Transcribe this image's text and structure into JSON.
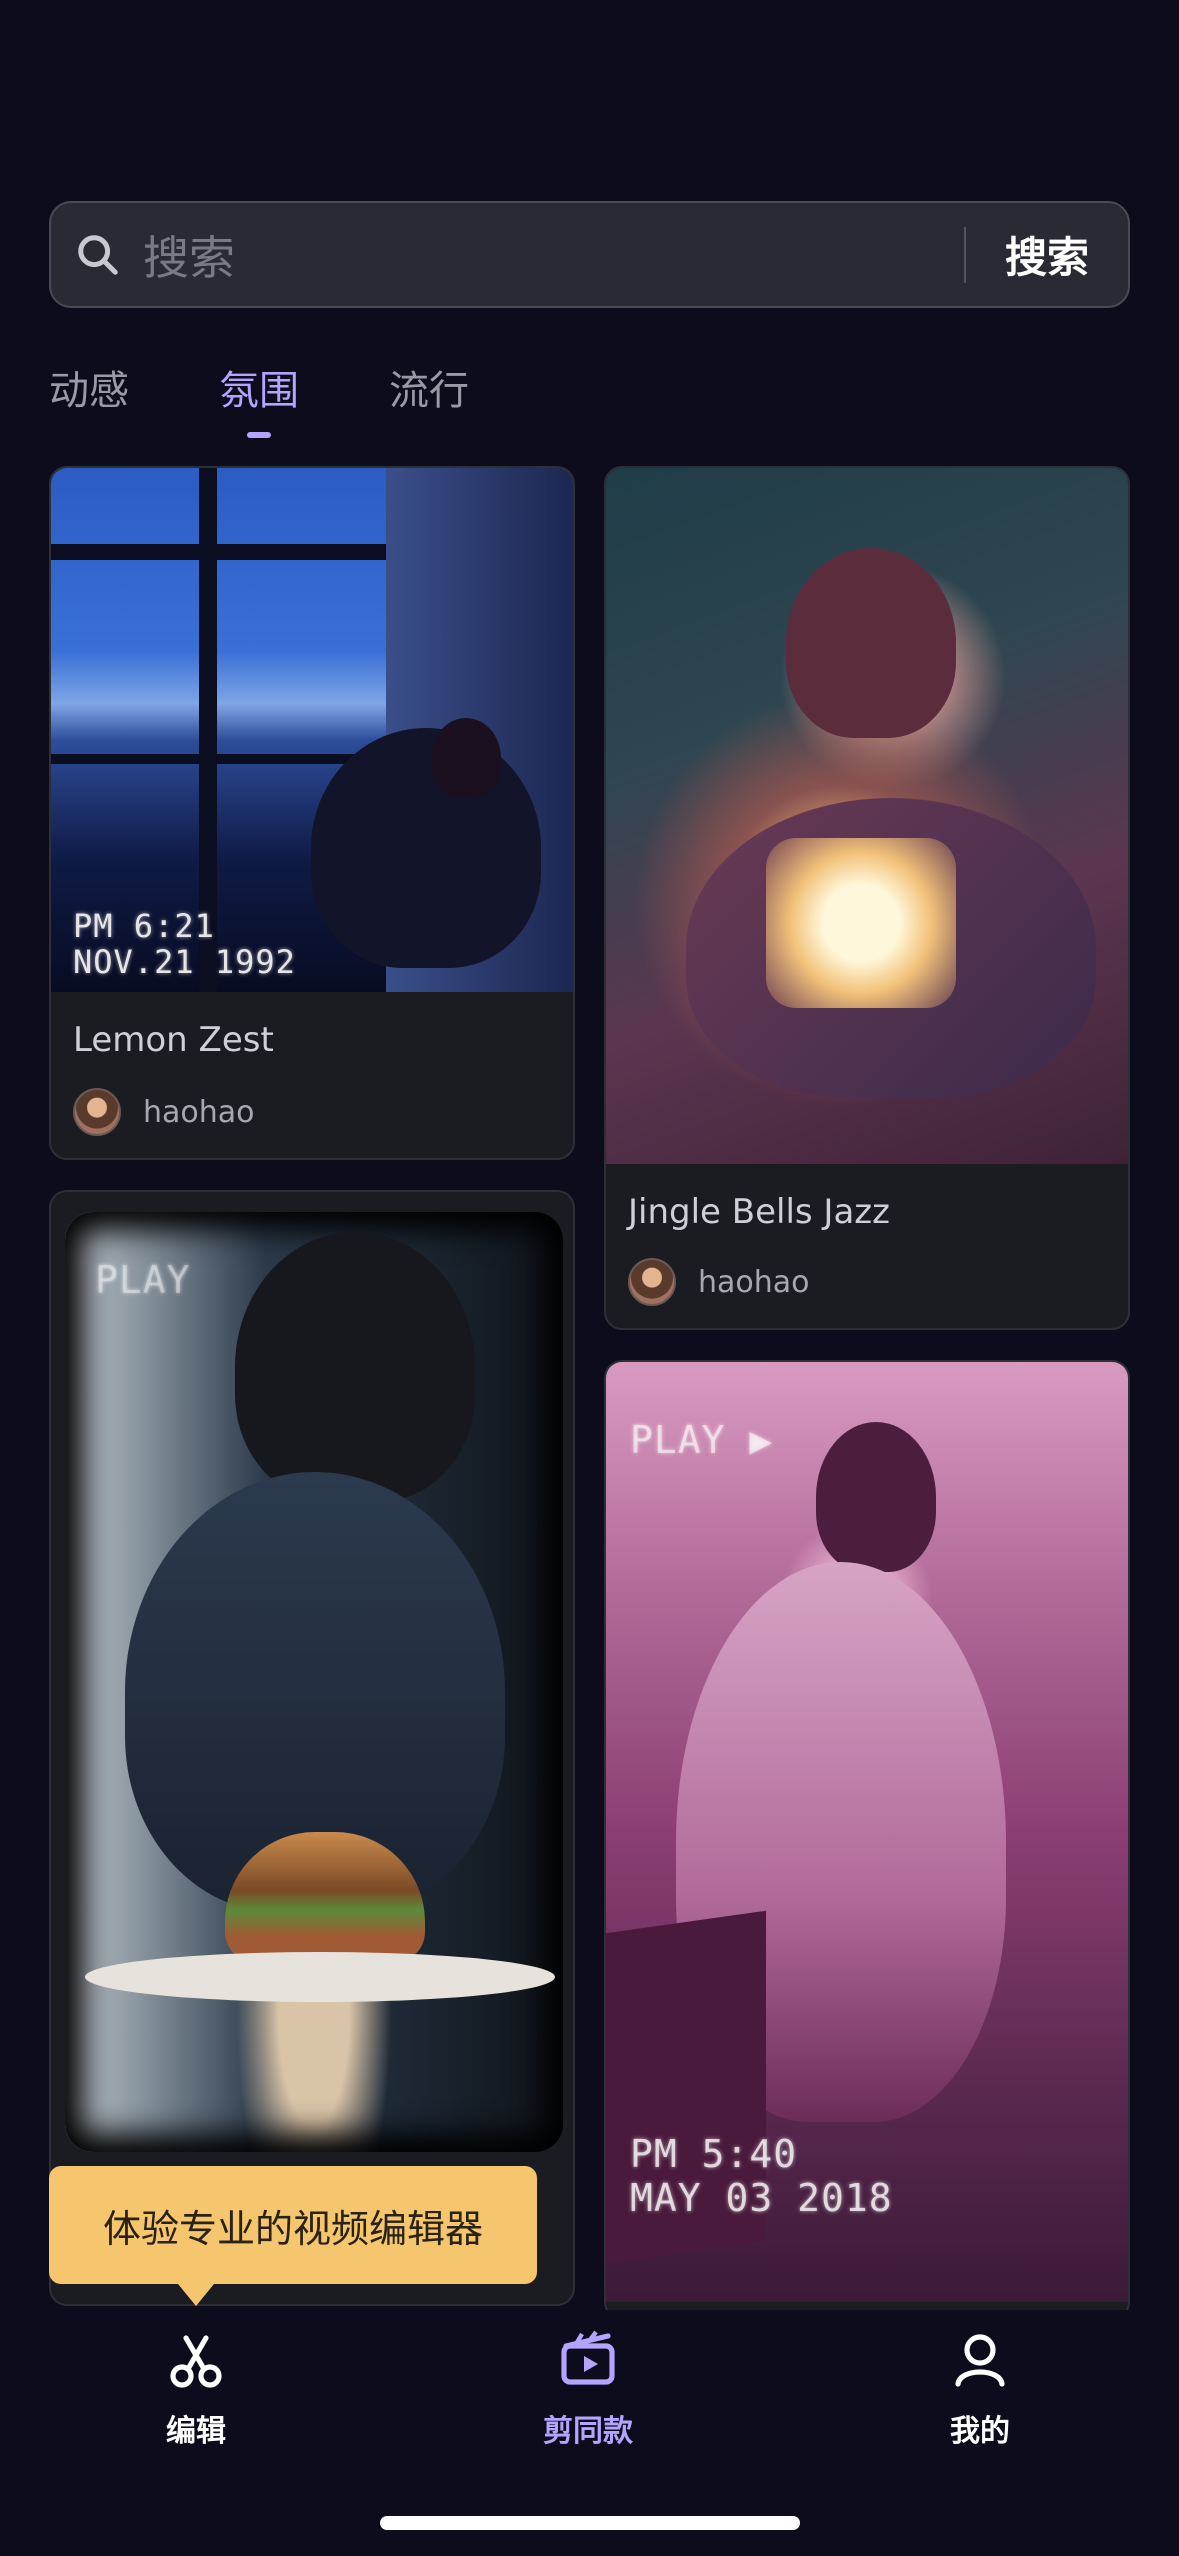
{
  "search": {
    "placeholder": "搜索",
    "button_label": "搜索"
  },
  "tabs": [
    {
      "label": "动感",
      "active": false
    },
    {
      "label": "氛围",
      "active": true
    },
    {
      "label": "流行",
      "active": false
    }
  ],
  "cards": [
    {
      "title": "Lemon Zest",
      "author": "haohao",
      "stamp": [
        "PM 6:21",
        "NOV.21 1992"
      ]
    },
    {
      "title": "Jingle Bells Jazz",
      "author": "haohao"
    },
    {
      "title": "",
      "author": "",
      "stamp": [
        "PLAY"
      ]
    },
    {
      "title": "",
      "author": "",
      "stamp": [
        "PLAY ▶",
        "PM 5:40",
        "MAY 03 2018"
      ]
    }
  ],
  "tooltip": {
    "text": "体验专业的视频编辑器"
  },
  "nav": [
    {
      "label": "编辑",
      "icon": "scissors-icon",
      "active": false
    },
    {
      "label": "剪同款",
      "icon": "clapperboard-icon",
      "active": true
    },
    {
      "label": "我的",
      "icon": "user-icon",
      "active": false
    }
  ],
  "colors": {
    "background": "#0c0c1c",
    "accent": "#b5a4ff",
    "tooltip": "#f5c66e"
  }
}
